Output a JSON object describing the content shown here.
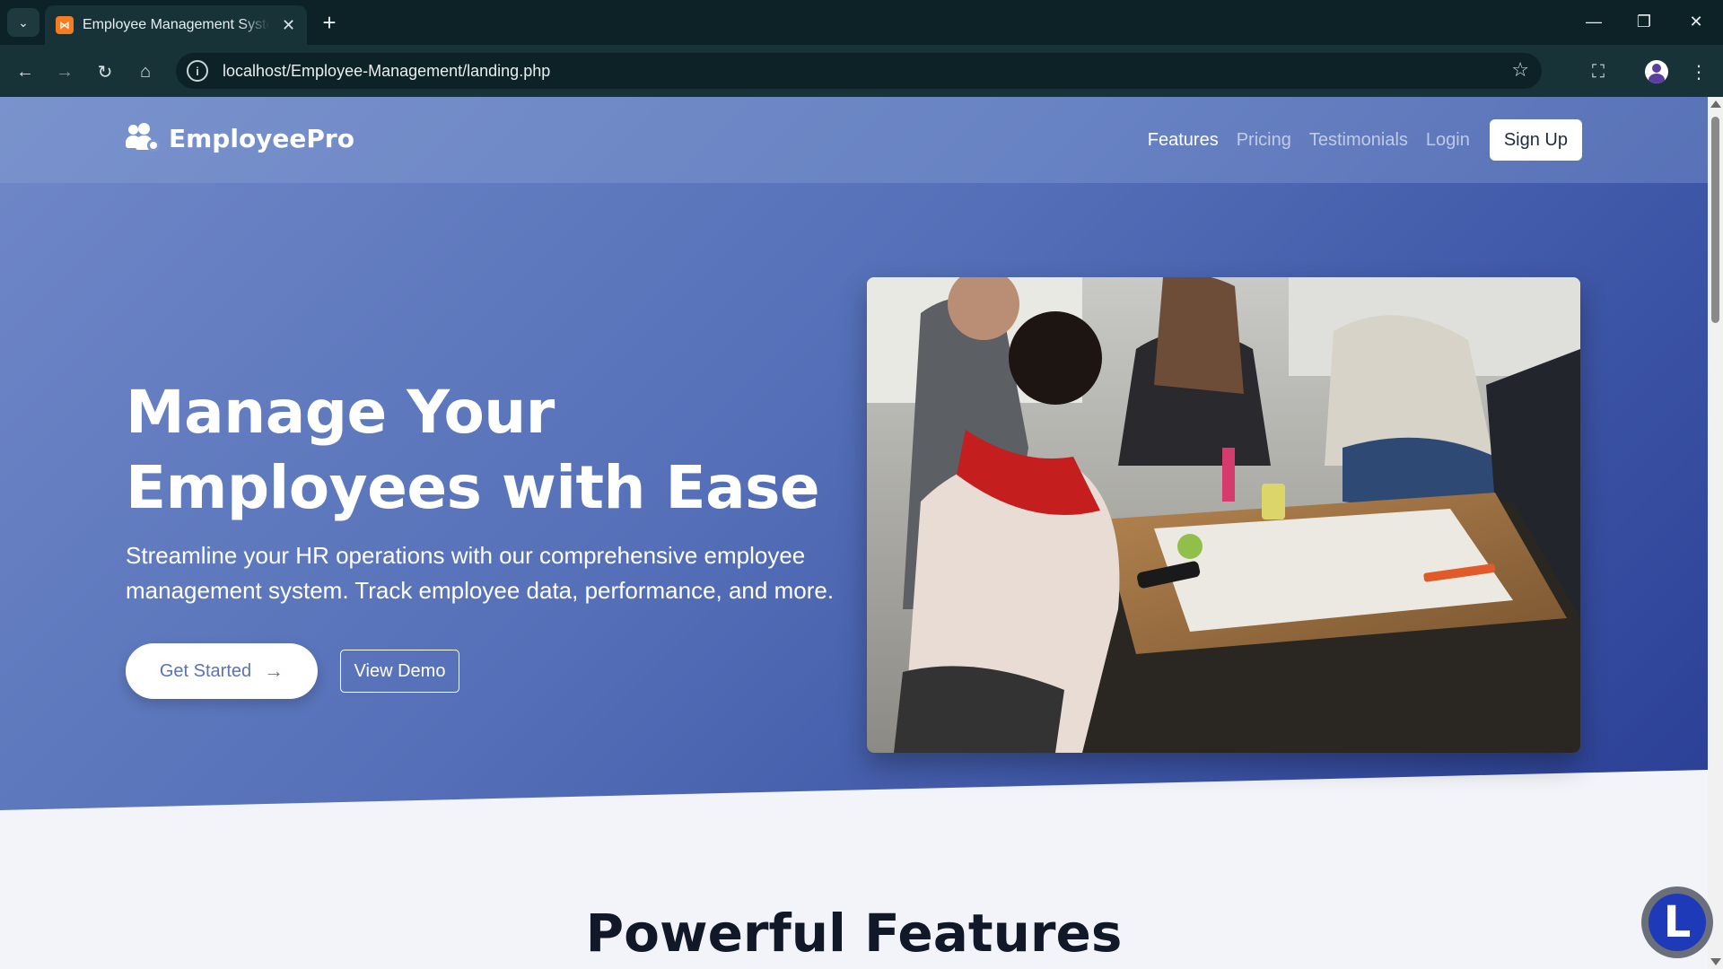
{
  "browser": {
    "tab_title": "Employee Management System",
    "url": "localhost/Employee-Management/landing.php"
  },
  "navbar": {
    "brand": "EmployeePro",
    "links": [
      "Features",
      "Pricing",
      "Testimonials",
      "Login"
    ],
    "active_link": "Features",
    "signup_label": "Sign Up"
  },
  "hero": {
    "headline_line1": "Manage Your",
    "headline_line2": "Employees with Ease",
    "lead_line1": "Streamline your HR operations with our comprehensive employee",
    "lead_line2": "management system. Track employee data, performance, and more.",
    "primary_cta": "Get Started",
    "secondary_cta": "View Demo",
    "image_alt": "Team collaborating around a table"
  },
  "features": {
    "title": "Powerful Features"
  },
  "floating_badge": {
    "letter": "L"
  },
  "colors": {
    "hero_gradient_start": "#7088c8",
    "hero_gradient_end": "#2a3f95",
    "page_background": "#f2f4f9",
    "chrome_dark": "#0c2226",
    "chrome_toolbar": "#173338"
  },
  "icons": {
    "brand": "users-gear-icon",
    "primary_cta": "arrow-right-icon"
  }
}
